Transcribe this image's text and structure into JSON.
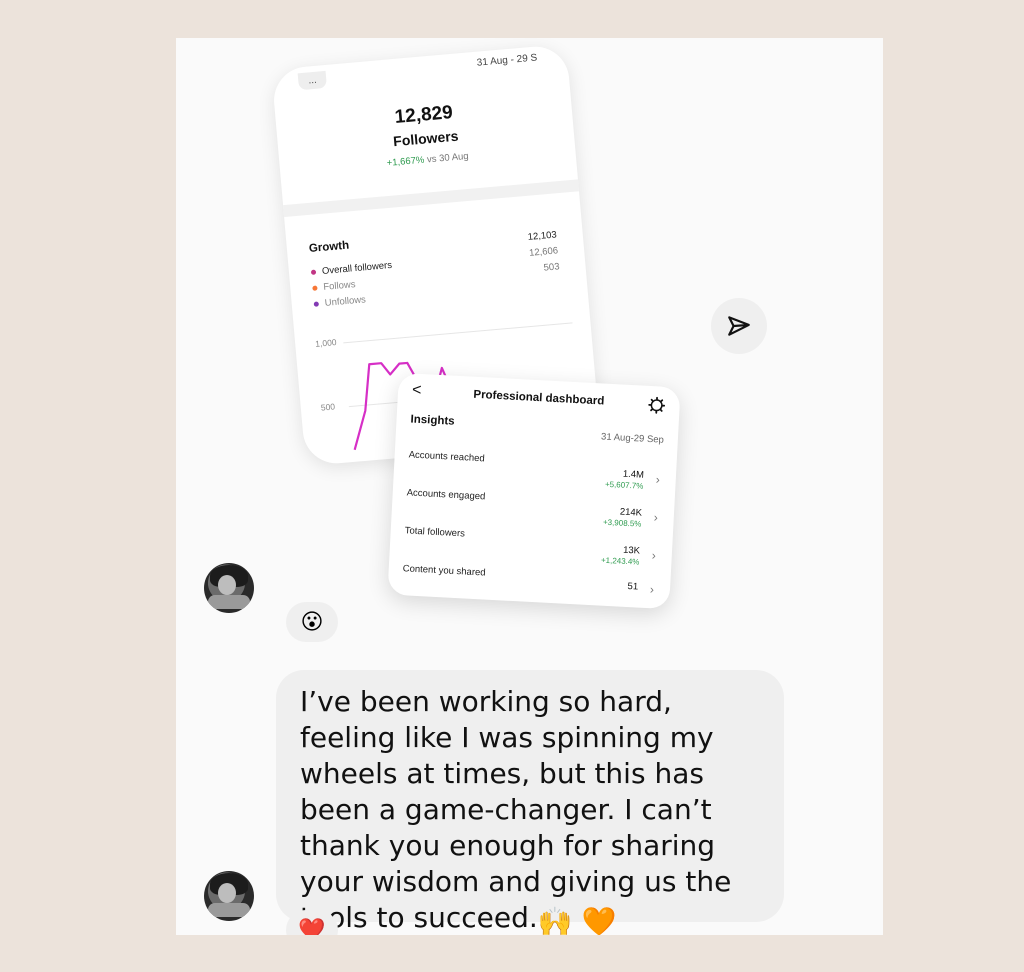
{
  "followers_card": {
    "top_left": "...",
    "top_right": "31 Aug - 29 S",
    "count": "12,829",
    "label": "Followers",
    "delta_pos": "+1,667%",
    "delta_rest": " vs 30 Aug",
    "growth_title": "Growth",
    "legend": [
      {
        "label": "Overall followers",
        "value": "12,103",
        "color": "#c13584"
      },
      {
        "label": "Follows",
        "value": "12,606",
        "color": "#f77737"
      },
      {
        "label": "Unfollows",
        "value": "503",
        "color": "#833ab4"
      }
    ],
    "ticks": [
      "1,000",
      "500"
    ],
    "trend_color": "#d62fc6"
  },
  "dashboard_card": {
    "back_glyph": "<",
    "title": "Professional dashboard",
    "section": "Insights",
    "range": "31 Aug-29 Sep",
    "rows": [
      {
        "label": "Accounts reached",
        "value": "1.4M",
        "delta": "+5,607.7%"
      },
      {
        "label": "Accounts engaged",
        "value": "214K",
        "delta": "+3,908.5%"
      },
      {
        "label": "Total followers",
        "value": "13K",
        "delta": "+1,243.4%"
      },
      {
        "label": "Content you shared",
        "value": "51",
        "delta": ""
      }
    ],
    "chevron": "›"
  },
  "reactions": {
    "first": "😮",
    "second": "❤️"
  },
  "message": {
    "text": "I’ve been working so hard, feeling like I was spinning my wheels at times, but this has been a game-changer. I can’t thank you enough for sharing your wisdom and giving us the tools to succeed.",
    "emoji_hands": "🙌",
    "emoji_heart": "🧡"
  },
  "icons": {
    "send": "send-icon",
    "settings": "settings-gear-icon"
  }
}
